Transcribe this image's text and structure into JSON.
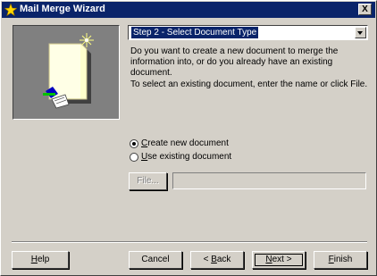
{
  "window": {
    "title": "Mail Merge Wizard",
    "close_glyph": "X"
  },
  "step_select": {
    "selected": "Step 2 - Select Document Type"
  },
  "description": {
    "line1": "Do you want to create a new document to merge the information into, or do you already have an existing document.",
    "line2": "To select an existing document, enter the name or click File."
  },
  "options": {
    "create_new": {
      "label_first": "C",
      "label_rest": "reate new document",
      "checked": true
    },
    "use_existing": {
      "label_first": "U",
      "label_rest": "se existing document",
      "checked": false
    }
  },
  "file_button": {
    "label": "File..."
  },
  "file_path": {
    "value": ""
  },
  "buttons": {
    "help": {
      "first": "H",
      "rest": "elp"
    },
    "cancel": {
      "label": "Cancel"
    },
    "back": {
      "pre": "< ",
      "first": "B",
      "rest": "ack"
    },
    "next": {
      "first": "N",
      "rest": "ext >"
    },
    "finish": {
      "first": "F",
      "rest": "inish"
    }
  },
  "icons": {
    "title": "wizard-star-icon",
    "illustration": "document-with-wand-icon"
  },
  "colors": {
    "titlebar": "#0a246a",
    "dialog": "#d4d0c8",
    "illustration_bg": "#808080",
    "document": "#ffffcc",
    "selection": "#0a246a"
  }
}
